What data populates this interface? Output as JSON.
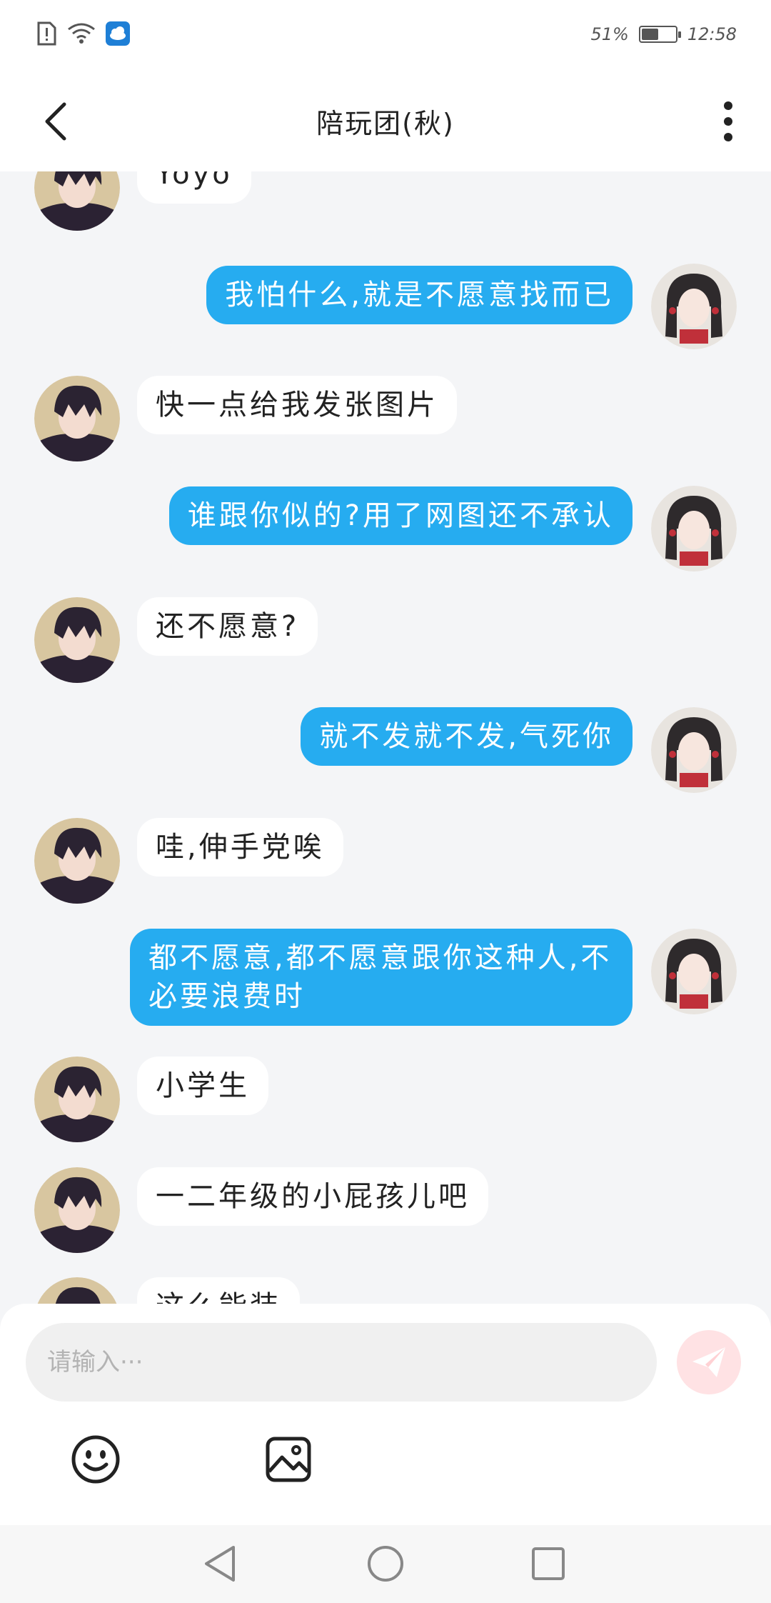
{
  "status_bar": {
    "battery_percent": "51%",
    "battery_level": 0.51,
    "time": "12:58",
    "icons": [
      "sim-alert-icon",
      "wifi-icon",
      "weather-app-icon"
    ]
  },
  "header": {
    "title": "陪玩团(秋)",
    "back_icon": "chevron-left-icon",
    "more_icon": "more-vertical-icon"
  },
  "messages": [
    {
      "side": "in",
      "text": "Yoyo"
    },
    {
      "side": "out",
      "text": "我怕什么,就是不愿意找而已"
    },
    {
      "side": "in",
      "text": "快一点给我发张图片"
    },
    {
      "side": "out",
      "text": "谁跟你似的?用了网图还不承认"
    },
    {
      "side": "in",
      "text": "还不愿意?"
    },
    {
      "side": "out",
      "text": "就不发就不发,气死你"
    },
    {
      "side": "in",
      "text": "哇,伸手党唉"
    },
    {
      "side": "out",
      "text": "都不愿意,都不愿意跟你这种人,不必要浪费时"
    },
    {
      "side": "in",
      "text": "小学生"
    },
    {
      "side": "in",
      "text": "一二年级的小屁孩儿吧"
    },
    {
      "side": "in",
      "text": "这么能装"
    }
  ],
  "composer": {
    "placeholder": "请输入···",
    "value": "",
    "send_icon": "send-icon",
    "emoji_icon": "emoji-icon",
    "image_icon": "image-icon"
  },
  "colors": {
    "outgoing_bubble": "#26acf0",
    "incoming_bubble": "#ffffff",
    "chat_background": "#f4f5f7",
    "send_button": "#ffe2e4"
  }
}
